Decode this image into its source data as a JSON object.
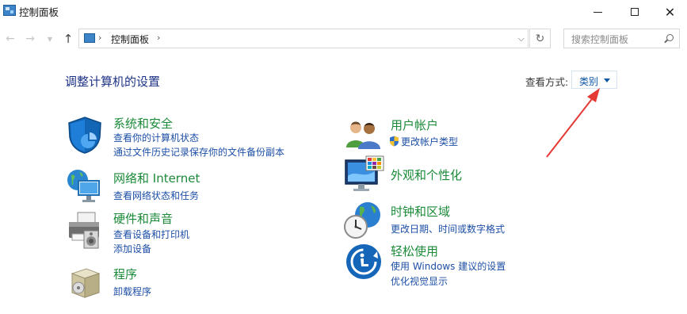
{
  "window": {
    "title": "控制面板"
  },
  "address": {
    "path": "控制面板"
  },
  "search": {
    "placeholder": "搜索控制面板"
  },
  "heading": "调整计算机的设置",
  "view_by": {
    "label": "查看方式:",
    "value": "类别"
  },
  "categories": [
    {
      "title": "系统和安全",
      "links": [
        "查看你的计算机状态",
        "通过文件历史记录保存你的文件备份副本"
      ]
    },
    {
      "title": "网络和 Internet",
      "links": [
        "查看网络状态和任务"
      ]
    },
    {
      "title": "硬件和声音",
      "links": [
        "查看设备和打印机",
        "添加设备"
      ]
    },
    {
      "title": "程序",
      "links": [
        "卸载程序"
      ]
    },
    {
      "title": "用户帐户",
      "links": [
        "更改帐户类型"
      ]
    },
    {
      "title": "外观和个性化",
      "links": []
    },
    {
      "title": "时钟和区域",
      "links": [
        "更改日期、时间或数字格式"
      ]
    },
    {
      "title": "轻松使用",
      "links": [
        "使用 Windows 建议的设置",
        "优化视觉显示"
      ]
    }
  ],
  "colors": {
    "category_title": "#1a8a38",
    "link": "#1d4fa6",
    "heading": "#1e3287",
    "annotation_arrow": "#e53935"
  }
}
